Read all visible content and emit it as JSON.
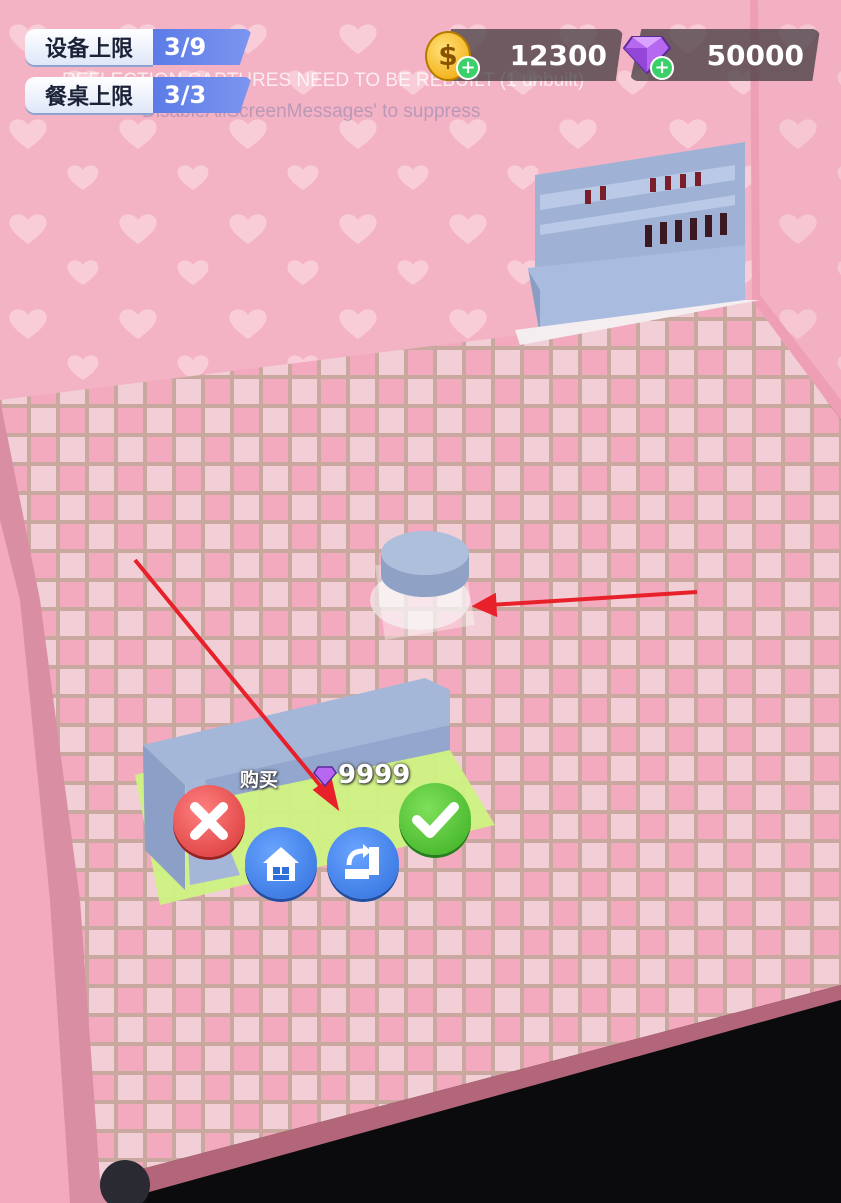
{
  "hud": {
    "equipment_limit": {
      "label": "设备上限",
      "value": "3/9"
    },
    "table_limit": {
      "label": "餐桌上限",
      "value": "3/3"
    },
    "coins": {
      "amount": "12300",
      "icon": "coin-icon"
    },
    "gems": {
      "amount": "50000",
      "icon": "gem-icon"
    }
  },
  "debug_messages": {
    "line1": "REFLECTION CAPTURES NEED TO BE REBUILT (1 unbuilt)",
    "line2": "DisableAllScreenMessages' to suppress"
  },
  "placement": {
    "buy_label": "购买",
    "price": "9999",
    "price_currency_icon": "gem-icon",
    "cancel_icon": "close-icon",
    "store_icon": "home-icon",
    "rotate_icon": "rotate-icon",
    "confirm_icon": "check-icon"
  },
  "colors": {
    "wall_pink": "#f4b8c8",
    "floor_tile": "#f1c9d2",
    "furniture_blue": "#a6b8d8",
    "placement_green": "#cff58a",
    "limit_blue": "#6b87ea",
    "cancel_red": "#e84a4a",
    "confirm_green": "#45c026",
    "action_blue": "#3f7de6",
    "arrow_red": "#e8202a"
  }
}
